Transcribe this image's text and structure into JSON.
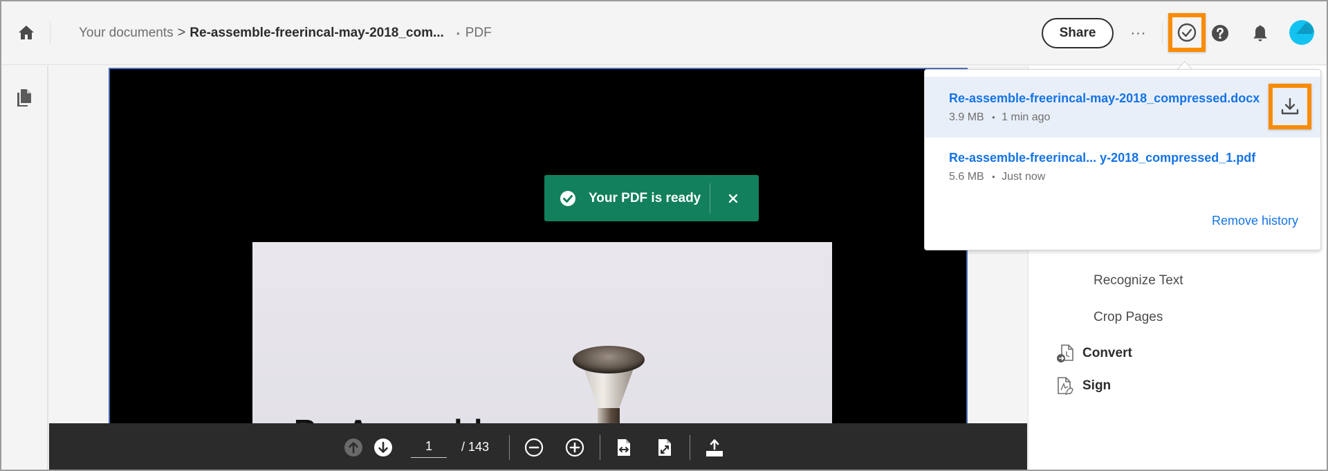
{
  "header": {
    "breadcrumb_root": "Your documents",
    "breadcrumb_separator": ">",
    "document_title": "Re-assemble-freerincal-may-2018_com...",
    "dot": "•",
    "document_type": "PDF",
    "share_label": "Share",
    "more_label": "···",
    "icons": {
      "home": "home-icon",
      "status": "check-circle-icon",
      "help": "help-icon",
      "notifications": "bell-icon",
      "avatar": "user-avatar"
    }
  },
  "colors": {
    "accent_blue": "#1473e6",
    "toast_green": "#12805c",
    "highlight_orange": "#fb8b00",
    "avatar_cyan": "#12c2f0"
  },
  "toast": {
    "message": "Your PDF is ready",
    "close_label": "×"
  },
  "history_popover": {
    "items": [
      {
        "name": "Re-assemble-freerincal-may-2018_compressed.docx",
        "size": "3.9 MB",
        "time": "1 min ago",
        "active": true
      },
      {
        "name": "Re-assemble-freerincal... y-2018_compressed_1.pdf",
        "size": "5.6 MB",
        "time": "Just now",
        "active": false
      }
    ],
    "separator": "•",
    "remove_history_label": "Remove history"
  },
  "right_panel": {
    "tools": [
      "Recognize Text",
      "Crop Pages"
    ],
    "categories": [
      {
        "label": "Convert",
        "icon": "convert-icon"
      },
      {
        "label": "Sign",
        "icon": "sign-icon"
      }
    ]
  },
  "document": {
    "page_text_fragment": "Re-Assemble"
  },
  "bottom_toolbar": {
    "current_page": "1",
    "total_pages": "/ 143"
  }
}
